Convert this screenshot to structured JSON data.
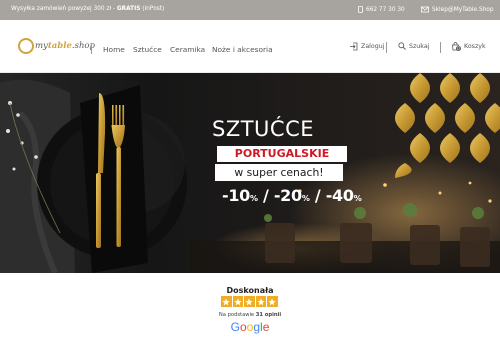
{
  "topbar": {
    "shipping_text": "Wysyłka zamówień powyżej 300 zł - ",
    "shipping_bold": "GRATIS",
    "shipping_tail": " (InPost)",
    "phone": "662 77 30 30",
    "email": "Sklep@MyTable.Shop"
  },
  "header": {
    "logo_my": "my",
    "logo_table": "table",
    "logo_shop": ".shop",
    "nav": [
      {
        "label": "Home"
      },
      {
        "label": "Sztućce"
      },
      {
        "label": "Ceramika"
      },
      {
        "label": "Noże i akcesoria"
      }
    ],
    "login_label": "Zaloguj",
    "search_label": "Szukaj",
    "cart_label": "Koszyk",
    "cart_count": "0"
  },
  "banner": {
    "line1": "SZTUĆCE",
    "line2": "PORTUGALSKIE",
    "line3": "w super cenach!",
    "discounts": [
      {
        "value": "-10",
        "unit": "%"
      },
      {
        "value": "-20",
        "unit": "%"
      },
      {
        "value": "-40",
        "unit": "%"
      }
    ]
  },
  "reviews": {
    "rating_label": "Doskonała",
    "stars": 5,
    "based_on_prefix": "Na podstawie ",
    "count_text": "31 opinii",
    "provider": "Google"
  },
  "colors": {
    "topbar_bg": "#a7a49f",
    "gold": "#d1a33b",
    "red": "#d01925",
    "star": "#f0ad26"
  }
}
